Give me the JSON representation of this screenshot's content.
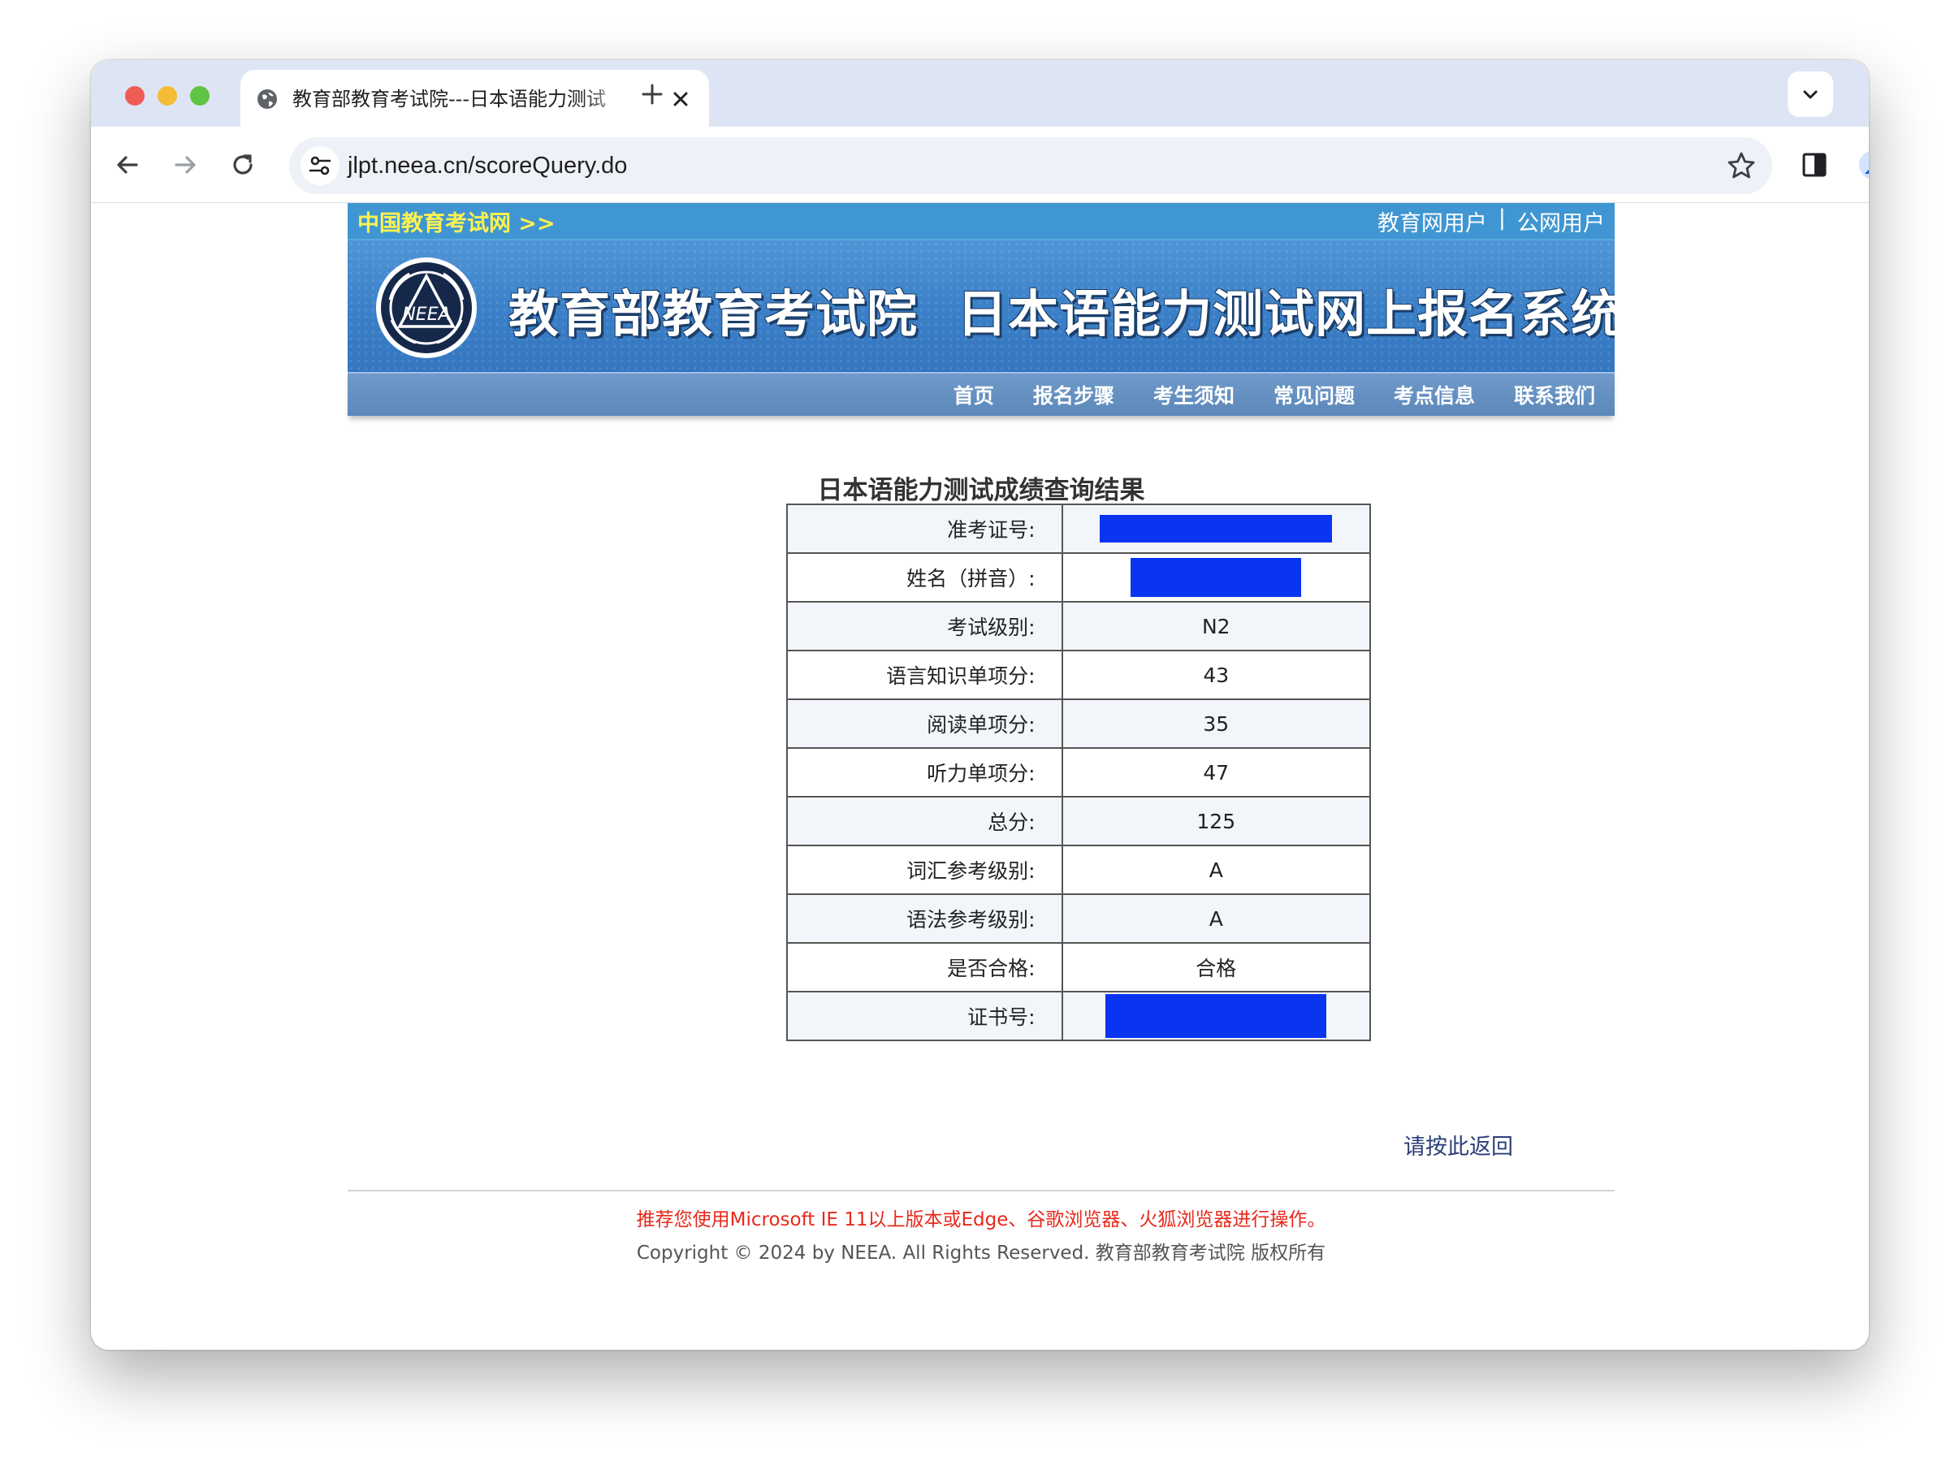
{
  "browser": {
    "tab_title": "教育部教育考试院---日本语能力测试",
    "url": "jlpt.neea.cn/scoreQuery.do"
  },
  "site": {
    "top_left_link": "中国教育考试网 >>",
    "top_right_links": [
      "教育网用户",
      "公网用户"
    ],
    "top_right_separator": "|",
    "banner_title_part1": "教育部教育考试院",
    "banner_title_part2": "日本语能力测试网上报名系统",
    "logo_text": "NEEA",
    "nav_items": [
      "首页",
      "报名步骤",
      "考生须知",
      "常见问题",
      "考点信息",
      "联系我们"
    ]
  },
  "result": {
    "title": "日本语能力测试成绩查询结果",
    "rows": [
      {
        "label": "准考证号:",
        "value": ""
      },
      {
        "label": "姓名（拼音）:",
        "value": ""
      },
      {
        "label": "考试级别:",
        "value": "N2"
      },
      {
        "label": "语言知识单项分:",
        "value": "43"
      },
      {
        "label": "阅读单项分:",
        "value": "35"
      },
      {
        "label": "听力单项分:",
        "value": "47"
      },
      {
        "label": "总分:",
        "value": "125"
      },
      {
        "label": "词汇参考级别:",
        "value": "A"
      },
      {
        "label": "语法参考级别:",
        "value": "A"
      },
      {
        "label": "是否合格:",
        "value": "合格"
      },
      {
        "label": "证书号:",
        "value": ""
      }
    ],
    "redaction_color": "#0a35f0",
    "return_link": "请按此返回"
  },
  "footer": {
    "note": "推荐您使用Microsoft IE 11以上版本或Edge、谷歌浏览器、火狐浏览器进行操作。",
    "copyright": "Copyright © 2024 by NEEA. All Rights Reserved. 教育部教育考试院 版权所有"
  },
  "colors": {
    "topbar": "#3f96d2",
    "topbar_link": "#fdf24f",
    "banner": "#3a7fc7",
    "navbar": "#6490c0",
    "footer_note": "#e8281b"
  }
}
